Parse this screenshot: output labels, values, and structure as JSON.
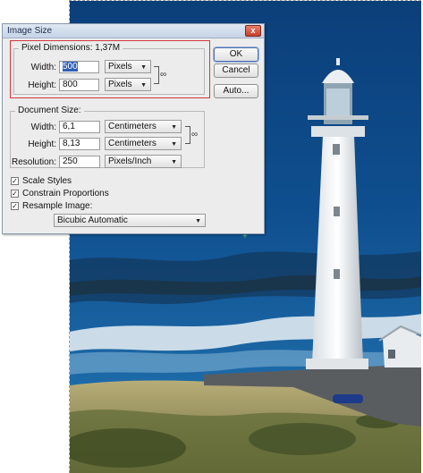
{
  "window": {
    "title": "Image Size",
    "close_glyph": "x"
  },
  "pixel_dimensions": {
    "legend": "Pixel Dimensions:",
    "size": "1,37M",
    "width_label": "Width:",
    "width_value": "500",
    "width_unit": "Pixels",
    "height_label": "Height:",
    "height_value": "800",
    "height_unit": "Pixels",
    "link_icon": "chain-link-icon"
  },
  "document_size": {
    "legend": "Document Size:",
    "width_label": "Width:",
    "width_value": "6,1",
    "width_unit": "Centimeters",
    "height_label": "Height:",
    "height_value": "8,13",
    "height_unit": "Centimeters",
    "resolution_label": "Resolution:",
    "resolution_value": "250",
    "resolution_unit": "Pixels/Inch",
    "link_icon": "chain-link-icon"
  },
  "options": {
    "scale_styles": {
      "label": "Scale Styles",
      "checked": true
    },
    "constrain_proportions": {
      "label": "Constrain Proportions",
      "checked": true
    },
    "resample_image": {
      "label": "Resample Image:",
      "checked": true
    },
    "resample_method": "Bicubic Automatic"
  },
  "buttons": {
    "ok": "OK",
    "cancel": "Cancel",
    "auto": "Auto..."
  },
  "colors": {
    "highlight_border": "#d4373b",
    "selection": "#2f5fb7",
    "dialog_bg": "#ececec",
    "guide_mark": "#5fd06b"
  },
  "background_image": {
    "subject": "white lighthouse on coast",
    "icon": "lighthouse-photo"
  }
}
